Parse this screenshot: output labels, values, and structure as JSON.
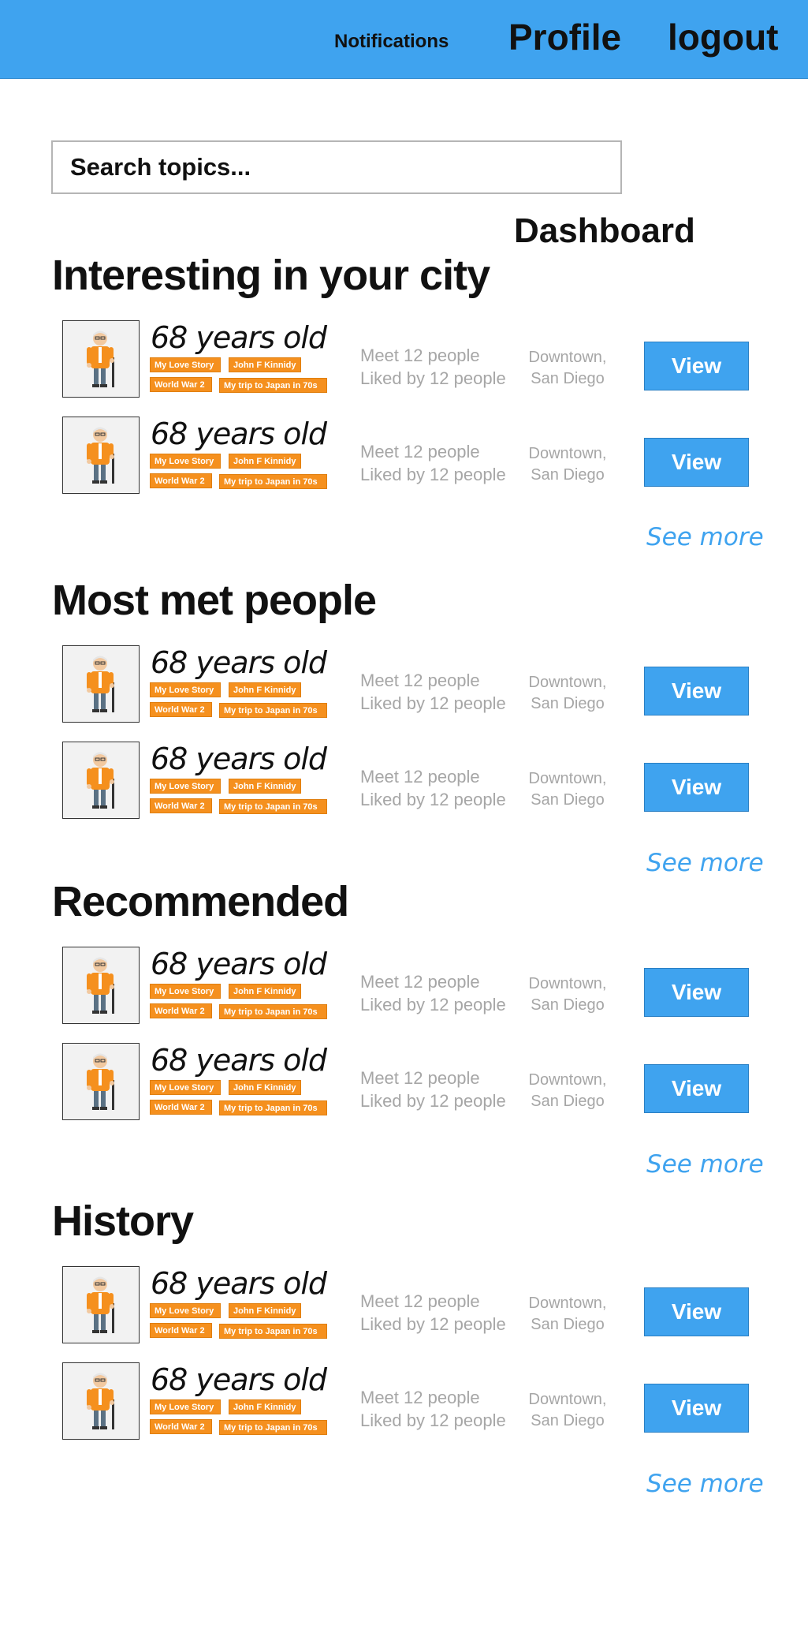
{
  "header": {
    "notifications_label": "Notifications",
    "profile_label": "Profile",
    "logout_label": "logout"
  },
  "search": {
    "placeholder": "Search topics..."
  },
  "dashboard_title": "Dashboard",
  "colors": {
    "accent": "#3fa3ef",
    "tag": "#f5901e",
    "muted_text": "#a6a6a6"
  },
  "sections": [
    {
      "title": "Interesting in your city",
      "see_more": "See more",
      "items": [
        {
          "avatar_icon": "elderly-man-icon",
          "age": "68 years old",
          "tags": [
            "My Love Story",
            "John F Kinnidy",
            "World War 2",
            "My trip to Japan in 70s"
          ],
          "meet": "Meet 12 people",
          "liked": "Liked by 12 people",
          "location_line1": "Downtown,",
          "location_line2": "San Diego",
          "button": "View"
        },
        {
          "avatar_icon": "elderly-man-icon",
          "age": "68 years old",
          "tags": [
            "My Love Story",
            "John F Kinnidy",
            "World War 2",
            "My trip to Japan in 70s"
          ],
          "meet": "Meet 12 people",
          "liked": "Liked by 12 people",
          "location_line1": "Downtown,",
          "location_line2": "San Diego",
          "button": "View"
        }
      ]
    },
    {
      "title": "Most met people",
      "see_more": "See more",
      "items": [
        {
          "avatar_icon": "elderly-man-icon",
          "age": "68 years old",
          "tags": [
            "My Love Story",
            "John F Kinnidy",
            "World War 2",
            "My trip to Japan in 70s"
          ],
          "meet": "Meet 12 people",
          "liked": "Liked by 12 people",
          "location_line1": "Downtown,",
          "location_line2": "San Diego",
          "button": "View"
        },
        {
          "avatar_icon": "elderly-man-icon",
          "age": "68 years old",
          "tags": [
            "My Love Story",
            "John F Kinnidy",
            "World War 2",
            "My trip to Japan in 70s"
          ],
          "meet": "Meet 12 people",
          "liked": "Liked by 12 people",
          "location_line1": "Downtown,",
          "location_line2": "San Diego",
          "button": "View"
        }
      ]
    },
    {
      "title": "Recommended",
      "see_more": "See more",
      "items": [
        {
          "avatar_icon": "elderly-man-icon",
          "age": "68 years old",
          "tags": [
            "My Love Story",
            "John F Kinnidy",
            "World War 2",
            "My trip to Japan in 70s"
          ],
          "meet": "Meet 12 people",
          "liked": "Liked by 12 people",
          "location_line1": "Downtown,",
          "location_line2": "San Diego",
          "button": "View"
        },
        {
          "avatar_icon": "elderly-man-icon",
          "age": "68 years old",
          "tags": [
            "My Love Story",
            "John F Kinnidy",
            "World War 2",
            "My trip to Japan in 70s"
          ],
          "meet": "Meet 12 people",
          "liked": "Liked by 12 people",
          "location_line1": "Downtown,",
          "location_line2": "San Diego",
          "button": "View"
        }
      ]
    },
    {
      "title": "History",
      "see_more": "See more",
      "items": [
        {
          "avatar_icon": "elderly-man-icon",
          "age": "68 years old",
          "tags": [
            "My Love Story",
            "John F Kinnidy",
            "World War 2",
            "My trip to Japan in 70s"
          ],
          "meet": "Meet 12 people",
          "liked": "Liked by 12 people",
          "location_line1": "Downtown,",
          "location_line2": "San Diego",
          "button": "View"
        },
        {
          "avatar_icon": "elderly-man-icon",
          "age": "68 years old",
          "tags": [
            "My Love Story",
            "John F Kinnidy",
            "World War 2",
            "My trip to Japan in 70s"
          ],
          "meet": "Meet 12 people",
          "liked": "Liked by 12 people",
          "location_line1": "Downtown,",
          "location_line2": "San Diego",
          "button": "View"
        }
      ]
    }
  ]
}
